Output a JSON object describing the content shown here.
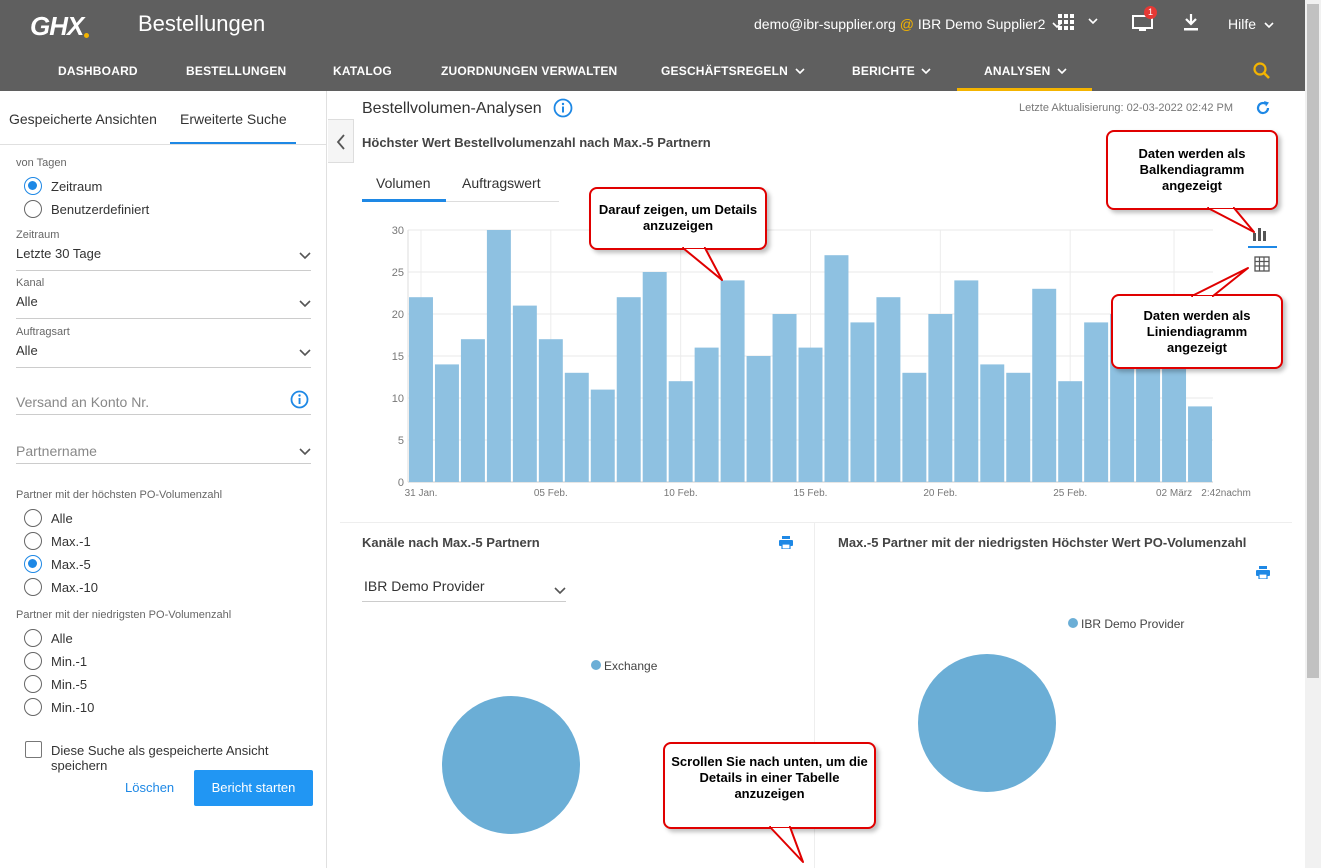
{
  "header": {
    "logo": "GHX",
    "title": "Bestellungen",
    "user_email": "demo@ibr-supplier.org",
    "user_at": "@",
    "user_org": "IBR Demo Supplier2",
    "notification_count": "1",
    "help_label": "Hilfe"
  },
  "nav": {
    "items": [
      "DASHBOARD",
      "BESTELLUNGEN",
      "KATALOG",
      "ZUORDNUNGEN VERWALTEN",
      "GESCHÄFTSREGELN",
      "BERICHTE",
      "ANALYSEN"
    ],
    "active": "ANALYSEN",
    "accent_color": "#f4b400"
  },
  "sidebar": {
    "tabs": [
      "Gespeicherte Ansichten",
      "Erweiterte Suche"
    ],
    "active_tab": "Erweiterte Suche",
    "days_label": "von Tagen",
    "days_options": [
      "Zeitraum",
      "Benutzerdefiniert"
    ],
    "days_selected": "Zeitraum",
    "period_label": "Zeitraum",
    "period_value": "Letzte 30 Tage",
    "channel_label": "Kanal",
    "channel_value": "Alle",
    "order_type_label": "Auftragsart",
    "order_type_value": "Alle",
    "account_placeholder": "Versand an Konto Nr.",
    "partner_placeholder": "Partnername",
    "top_partners_label": "Partner mit der höchsten PO-Volumenzahl",
    "top_partners_options": [
      "Alle",
      "Max.-1",
      "Max.-5",
      "Max.-10"
    ],
    "top_partners_selected": "Max.-5",
    "bottom_partners_label": "Partner mit der niedrigsten PO-Volumenzahl",
    "bottom_partners_options": [
      "Alle",
      "Min.-1",
      "Min.-5",
      "Min.-10"
    ],
    "save_checkbox_label": "Diese Suche als gespeicherte Ansicht speichern",
    "clear_label": "Löschen",
    "run_label": "Bericht starten"
  },
  "main": {
    "title": "Bestellvolumen-Analysen",
    "last_update": "Letzte Aktualisierung: 02-03-2022 02:42 PM",
    "chart_title": "Höchster Wert Bestellvolumenzahl nach Max.-5 Partnern",
    "chart_tabs": [
      "Volumen",
      "Auftragswert"
    ],
    "active_chart_tab": "Volumen",
    "channels_title": "Kanäle nach Max.-5 Partnern",
    "provider_select": "IBR Demo Provider",
    "channels_legend": "Exchange",
    "lowest_title": "Max.-5 Partner mit der niedrigsten Höchster Wert PO-Volumenzahl",
    "lowest_legend": "IBR Demo Provider"
  },
  "callouts": {
    "hover": "Darauf zeigen, um Details anzuzeigen",
    "bar_mode": "Daten werden als Balkendiagramm angezeigt",
    "line_mode": "Daten werden als Liniendiagramm angezeigt",
    "scroll": "Scrollen Sie nach unten, um die Details in einer Tabelle anzuzeigen"
  },
  "chart_data": {
    "type": "bar",
    "title": "Höchster Wert Bestellvolumenzahl nach Max.-5 Partnern",
    "x_tick_labels": [
      "31 Jan.",
      "05 Feb.",
      "10 Feb.",
      "15 Feb.",
      "20 Feb.",
      "25 Feb.",
      "02 März",
      "2:42nachm"
    ],
    "y_ticks": [
      0,
      5,
      10,
      15,
      20,
      25,
      30
    ],
    "ylim": [
      0,
      30
    ],
    "values": [
      22,
      14,
      17,
      30,
      21,
      17,
      13,
      11,
      22,
      25,
      12,
      16,
      24,
      15,
      20,
      16,
      27,
      19,
      22,
      13,
      20,
      24,
      14,
      13,
      23,
      12,
      19,
      20,
      17,
      16,
      9
    ],
    "bar_color": "#8ec1e1",
    "grid": true
  }
}
